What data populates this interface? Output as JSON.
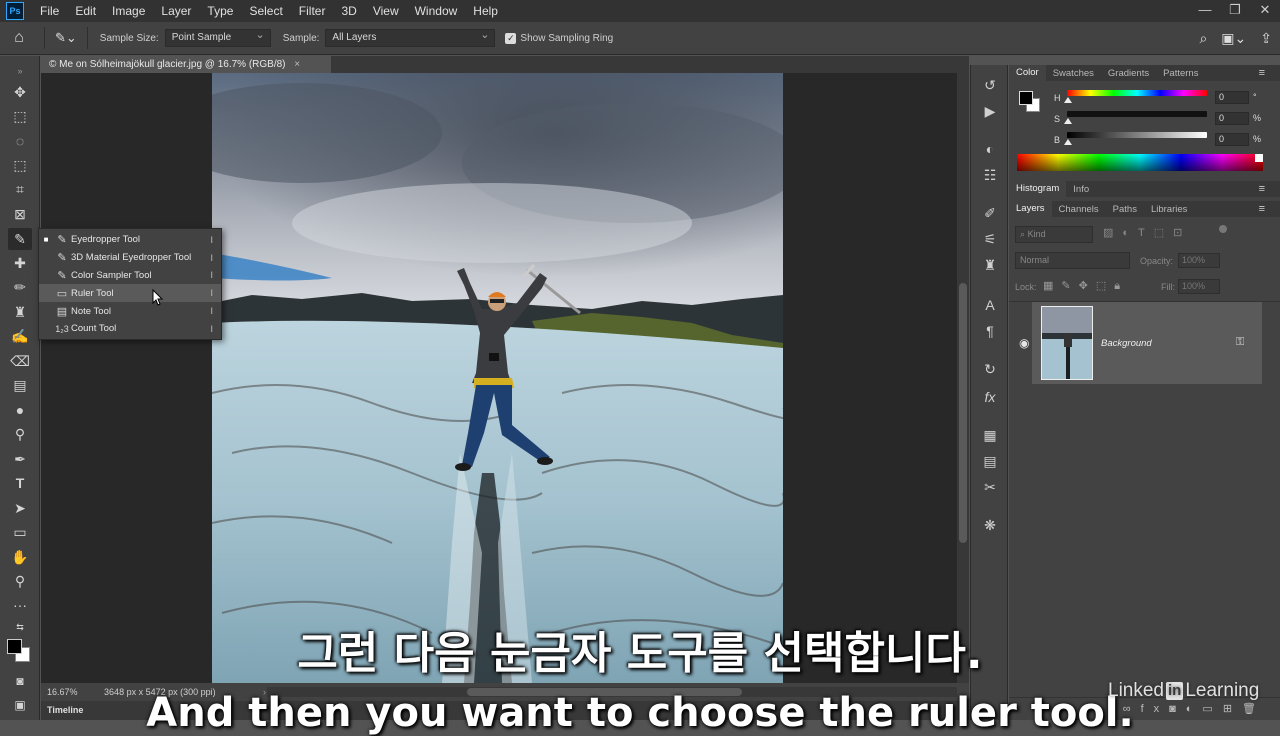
{
  "app": {
    "logo": "Ps",
    "menu": [
      "File",
      "Edit",
      "Image",
      "Layer",
      "Type",
      "Select",
      "Filter",
      "3D",
      "View",
      "Window",
      "Help"
    ],
    "window_controls": [
      "—",
      "❐",
      "✕"
    ]
  },
  "options_bar": {
    "sample_size_label": "Sample Size:",
    "sample_size_value": "Point Sample",
    "sample_label": "Sample:",
    "sample_value": "All Layers",
    "show_sampling_ring_label": "Show Sampling Ring",
    "show_sampling_ring_checked": true
  },
  "document": {
    "tab_title": "© Me on Sólheimajökull glacier.jpg @ 16.7% (RGB/8)",
    "tab_close": "×",
    "zoom": "16.67%",
    "doc_info": "3648 px x 5472 px (300 ppi)",
    "timeline_label": "Timeline"
  },
  "tool_flyout": {
    "items": [
      {
        "label": "Eyedropper Tool",
        "key": "I",
        "icon": "eyedropper-icon",
        "glyph": "✎",
        "selected": true
      },
      {
        "label": "3D Material Eyedropper Tool",
        "key": "I",
        "icon": "3d-material-eyedropper-icon",
        "glyph": "✎",
        "selected": false
      },
      {
        "label": "Color Sampler Tool",
        "key": "I",
        "icon": "color-sampler-icon",
        "glyph": "✎",
        "selected": false
      },
      {
        "label": "Ruler Tool",
        "key": "I",
        "icon": "ruler-icon",
        "glyph": "▭",
        "selected": false
      },
      {
        "label": "Note Tool",
        "key": "I",
        "icon": "note-icon",
        "glyph": "▤",
        "selected": false
      },
      {
        "label": "Count Tool",
        "key": "I",
        "icon": "count-icon",
        "glyph": "1₂3",
        "selected": false
      }
    ],
    "hovered": "Ruler Tool"
  },
  "color_panel": {
    "tabs": [
      "Color",
      "Swatches",
      "Gradients",
      "Patterns"
    ],
    "active_tab": "Color",
    "sliders": [
      {
        "label": "H",
        "value": "0",
        "unit": "°"
      },
      {
        "label": "S",
        "value": "0",
        "unit": "%"
      },
      {
        "label": "B",
        "value": "0",
        "unit": "%"
      }
    ]
  },
  "histogram_panel": {
    "tabs": [
      "Histogram",
      "Info"
    ],
    "active_tab": "Histogram"
  },
  "layers_panel": {
    "tabs": [
      "Layers",
      "Channels",
      "Paths",
      "Libraries"
    ],
    "active_tab": "Layers",
    "filter_placeholder": "Kind",
    "blend_mode": "Normal",
    "opacity_label": "Opacity:",
    "opacity_value": "100%",
    "lock_label": "Lock:",
    "fill_label": "Fill:",
    "fill_value": "100%",
    "layers": [
      {
        "name": "Background",
        "visible": true,
        "locked": true
      }
    ]
  },
  "subtitles": {
    "korean": "그런 다음 눈금자 도구를 선택합니다.",
    "english": "And then you want to choose the ruler tool."
  },
  "watermark": {
    "pre": "Linked",
    "in": "in",
    "post": "Learning"
  },
  "colors": {
    "foreground": "#000000",
    "background": "#ffffff",
    "ps_blue": "#31a8ff"
  }
}
